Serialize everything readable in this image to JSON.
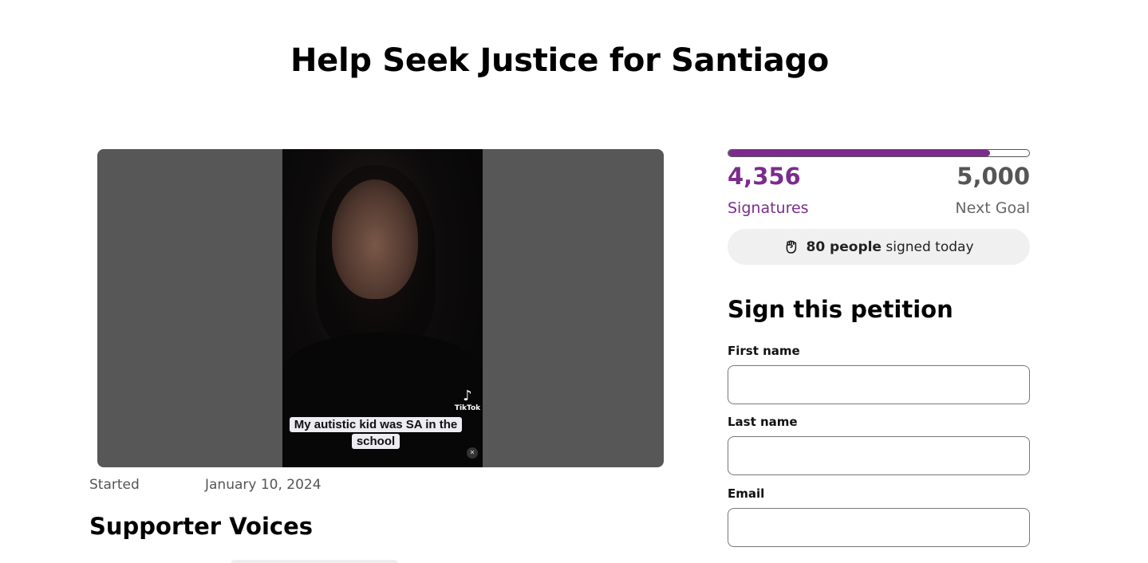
{
  "page": {
    "title": "Help Seek Justice for Santiago"
  },
  "media": {
    "caption": "My autistic kid was SA in the school",
    "watermark": "TikTok",
    "icons": [
      "tiktok-logo-icon",
      "muted-speaker-icon"
    ]
  },
  "meta": {
    "started_label": "Started",
    "started_date": "January 10, 2024"
  },
  "voices": {
    "heading": "Supporter Voices"
  },
  "progress": {
    "signatures": "4,356",
    "signatures_label": "Signatures",
    "goal": "5,000",
    "goal_label": "Next Goal",
    "fraction": 0.8712,
    "accent_color": "#7b2c8c"
  },
  "today": {
    "icon": "raised-fist-icon",
    "count_text": "80 people",
    "suffix_text": "signed today"
  },
  "form": {
    "heading": "Sign this petition",
    "first_name_label": "First name",
    "first_name_value": "",
    "last_name_label": "Last name",
    "last_name_value": "",
    "email_label": "Email",
    "email_value": ""
  }
}
